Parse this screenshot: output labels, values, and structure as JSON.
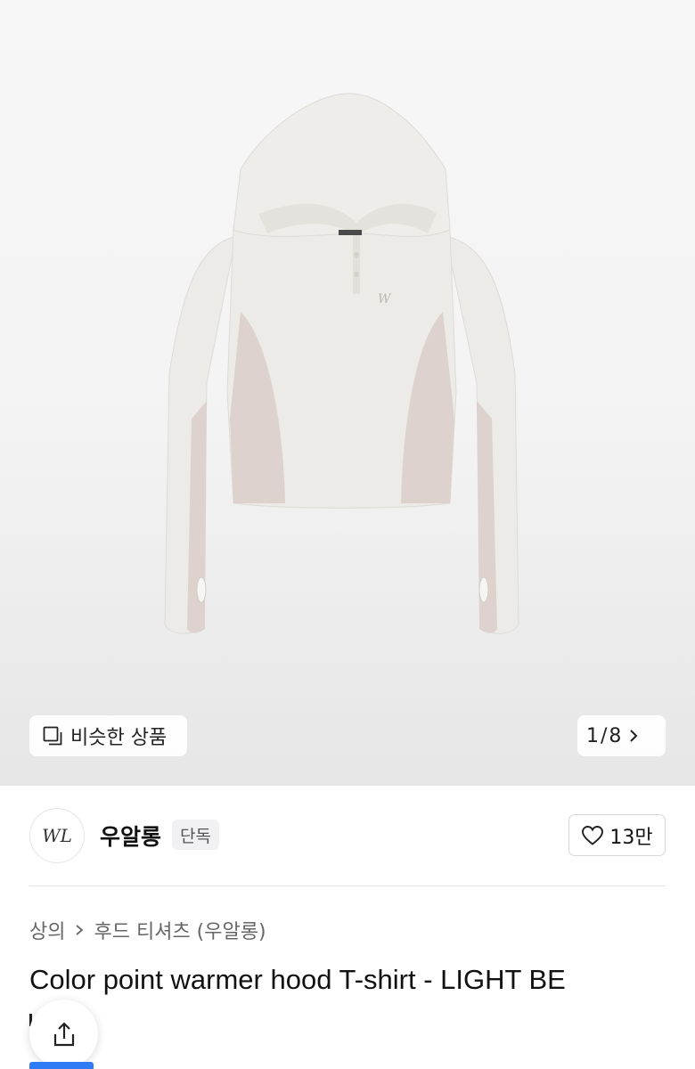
{
  "similar_button": {
    "label": "비슷한 상품",
    "icon": "copy-icon"
  },
  "pager": {
    "current": "1",
    "separator": "/",
    "total": "8",
    "icon": "chevron-right-icon"
  },
  "brand": {
    "logo_text": "WL",
    "name": "우알롱",
    "badge": "단독"
  },
  "like": {
    "count": "13만",
    "icon": "heart-icon"
  },
  "breadcrumb": {
    "category": "상의",
    "subcategory": "후드 티셔츠 (우알롱)",
    "icon": "chevron-right-icon"
  },
  "product": {
    "title": "Color point warmer hood T-shirt - LIGHT BE"
  },
  "share": {
    "icon": "share-icon"
  },
  "colors": {
    "accent_blue": "#2f7bf6",
    "garment_main": "#ebe9e5",
    "garment_panel": "#ddd2cd"
  }
}
